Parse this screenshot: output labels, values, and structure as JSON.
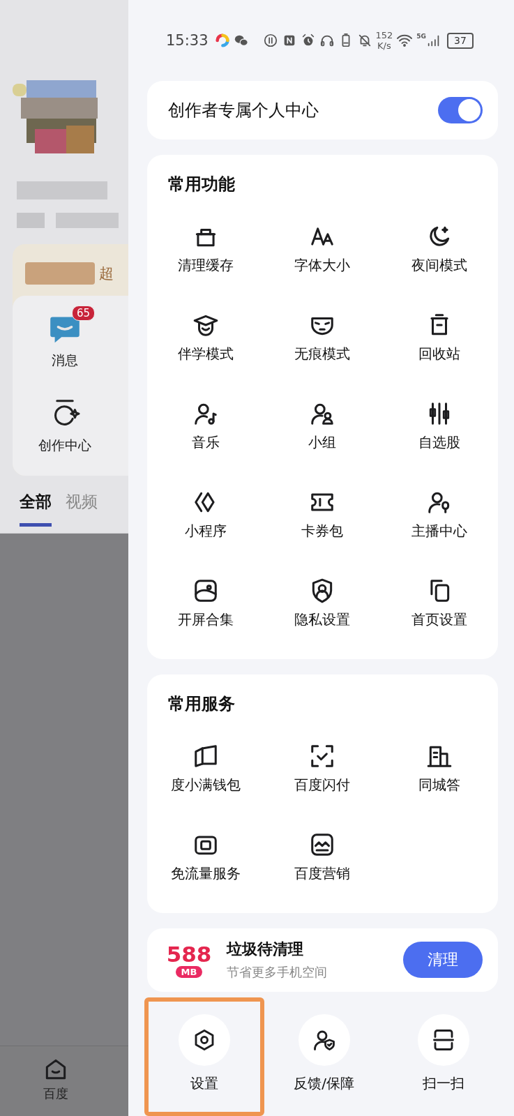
{
  "status_bar": {
    "time": "15:33",
    "speed_value": "152",
    "speed_unit": "K/s",
    "network": "5G",
    "battery": "37"
  },
  "background_page": {
    "vip_text": "超",
    "shortcuts": [
      {
        "label": "消息",
        "badge": "65"
      },
      {
        "label": "创作中心"
      }
    ],
    "tabs": [
      {
        "label": "全部",
        "selected": true
      },
      {
        "label": "视频",
        "selected": false
      }
    ],
    "bottom_nav": [
      {
        "label": "百度"
      }
    ]
  },
  "drawer": {
    "creator_toggle": {
      "label": "创作者专属个人中心",
      "on": true
    },
    "sections": [
      {
        "title": "常用功能",
        "items": [
          {
            "label": "清理缓存"
          },
          {
            "label": "字体大小"
          },
          {
            "label": "夜间模式"
          },
          {
            "label": "伴学模式"
          },
          {
            "label": "无痕模式"
          },
          {
            "label": "回收站"
          },
          {
            "label": "音乐"
          },
          {
            "label": "小组"
          },
          {
            "label": "自选股"
          },
          {
            "label": "小程序"
          },
          {
            "label": "卡券包"
          },
          {
            "label": "主播中心"
          },
          {
            "label": "开屏合集"
          },
          {
            "label": "隐私设置"
          },
          {
            "label": "首页设置"
          }
        ]
      },
      {
        "title": "常用服务",
        "items": [
          {
            "label": "度小满钱包"
          },
          {
            "label": "百度闪付"
          },
          {
            "label": "同城答"
          },
          {
            "label": "免流量服务"
          },
          {
            "label": "百度营销"
          }
        ]
      }
    ],
    "cleanup": {
      "amount": "588",
      "unit": "MB",
      "title": "垃圾待清理",
      "subtitle": "节省更多手机空间",
      "button": "清理"
    },
    "bottom_actions": [
      {
        "label": "设置",
        "highlighted": true
      },
      {
        "label": "反馈/保障",
        "highlighted": false
      },
      {
        "label": "扫一扫",
        "highlighted": false
      }
    ]
  }
}
